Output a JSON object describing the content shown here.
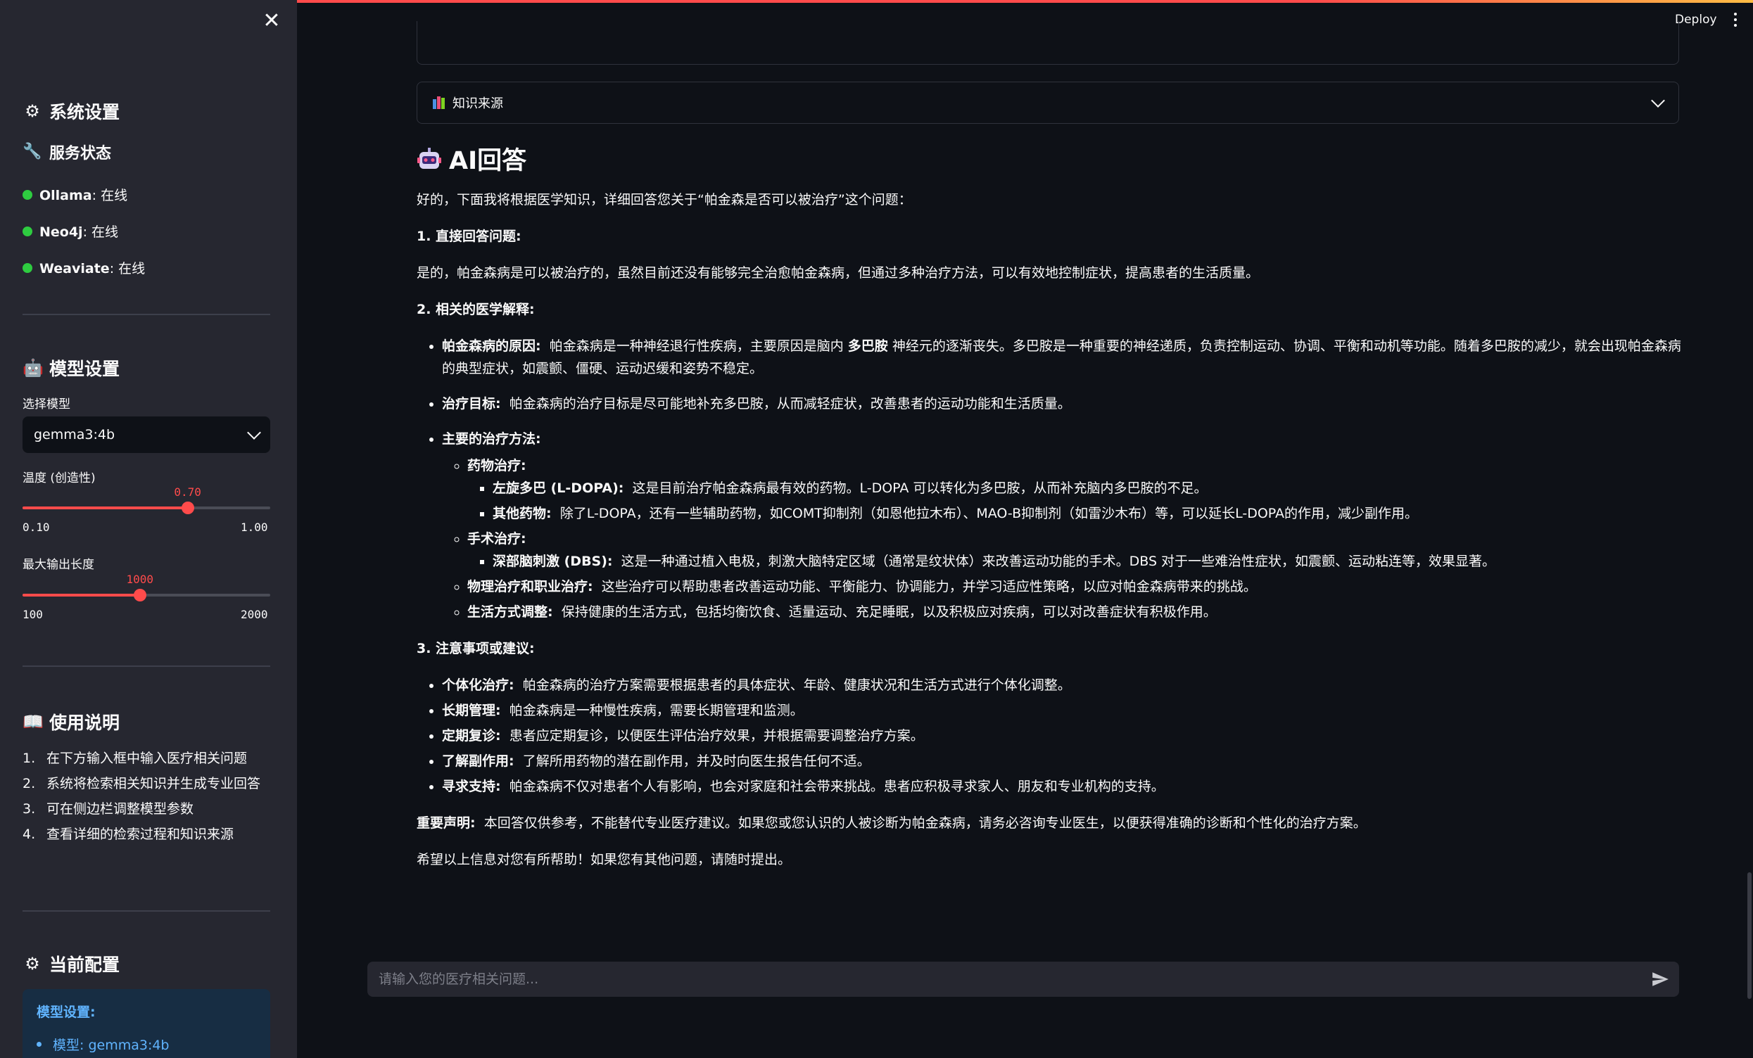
{
  "header": {
    "deploy_label": "Deploy"
  },
  "sidebar": {
    "system_settings": "系统设置",
    "service_status": "服务状态",
    "services": [
      {
        "name": "Ollama",
        "status": ": 在线"
      },
      {
        "name": "Neo4j",
        "status": ": 在线"
      },
      {
        "name": "Weaviate",
        "status": ": 在线"
      }
    ],
    "model_settings": "模型设置",
    "select_model_label": "选择模型",
    "selected_model": "gemma3:4b",
    "temperature": {
      "label": "温度 (创造性)",
      "value": "0.70",
      "fraction": 0.6667,
      "min": "0.10",
      "max": "1.00"
    },
    "max_length": {
      "label": "最大输出长度",
      "value": "1000",
      "fraction": 0.4737,
      "min": "100",
      "max": "2000"
    },
    "usage_title": "使用说明",
    "usage_items": [
      {
        "num": "1.",
        "text": "在下方输入框中输入医疗相关问题"
      },
      {
        "num": "2.",
        "text": "系统将检索相关知识并生成专业回答"
      },
      {
        "num": "3.",
        "text": "可在侧边栏调整模型参数"
      },
      {
        "num": "4.",
        "text": "查看详细的检索过程和知识来源"
      }
    ],
    "current_config": "当前配置",
    "config_box": {
      "title": "模型设置:",
      "item": "模型: gemma3:4b"
    }
  },
  "main": {
    "expander_label": "知识来源",
    "answer_title": "AI回答",
    "intro": "好的，下面我将根据医学知识，详细回答您关于“帕金森是否可以被治疗”这个问题：",
    "s1_title": "1. 直接回答问题:",
    "s1_text": "是的，帕金森病是可以被治疗的，虽然目前还没有能够完全治愈帕金森病，但通过多种治疗方法，可以有效地控制症状，提高患者的生活质量。",
    "s2_title": "2. 相关的医学解释:",
    "cause_label": "帕金森病的原因:",
    "cause_text_a": "帕金森病是一种神经退行性疾病，主要原因是脑内",
    "cause_bold": "多巴胺",
    "cause_text_b": "神经元的逐渐丧失。多巴胺是一种重要的神经递质，负责控制运动、协调、平衡和动机等功能。随着多巴胺的减少，就会出现帕金森病的典型症状，如震颤、僵硬、运动迟缓和姿势不稳定。",
    "goal_label": "治疗目标:",
    "goal_text": "帕金森病的治疗目标是尽可能地补充多巴胺，从而减轻症状，改善患者的运动功能和生活质量。",
    "methods_label": "主要的治疗方法:",
    "drug_label": "药物治疗:",
    "ldopa_label": "左旋多巴 (L-DOPA):",
    "ldopa_text": "这是目前治疗帕金森病最有效的药物。L-DOPA 可以转化为多巴胺，从而补充脑内多巴胺的不足。",
    "other_label": "其他药物:",
    "other_text": "除了L-DOPA，还有一些辅助药物，如COMT抑制剂（如恩他拉木布）、MAO-B抑制剂（如雷沙木布）等，可以延长L-DOPA的作用，减少副作用。",
    "surgery_label": "手术治疗:",
    "dbs_label": "深部脑刺激 (DBS):",
    "dbs_text": "这是一种通过植入电极，刺激大脑特定区域（通常是纹状体）来改善运动功能的手术。DBS 对于一些难治性症状，如震颤、运动粘连等，效果显著。",
    "pt_label": "物理治疗和职业治疗:",
    "pt_text": "这些治疗可以帮助患者改善运动功能、平衡能力、协调能力，并学习适应性策略，以应对帕金森病带来的挑战。",
    "life_label": "生活方式调整:",
    "life_text": "保持健康的生活方式，包括均衡饮食、适量运动、充足睡眠，以及积极应对疾病，可以对改善症状有积极作用。",
    "s3_title": "3. 注意事项或建议:",
    "notes": [
      {
        "label": "个体化治疗:",
        "text": "帕金森病的治疗方案需要根据患者的具体症状、年龄、健康状况和生活方式进行个体化调整。"
      },
      {
        "label": "长期管理:",
        "text": "帕金森病是一种慢性疾病，需要长期管理和监测。"
      },
      {
        "label": "定期复诊:",
        "text": "患者应定期复诊，以便医生评估治疗效果，并根据需要调整治疗方案。"
      },
      {
        "label": "了解副作用:",
        "text": "了解所用药物的潜在副作用，并及时向医生报告任何不适。"
      },
      {
        "label": "寻求支持:",
        "text": "帕金森病不仅对患者个人有影响，也会对家庭和社会带来挑战。患者应积极寻求家人、朋友和专业机构的支持。"
      }
    ],
    "disclaimer_label": "重要声明:",
    "disclaimer_text": "本回答仅供参考，不能替代专业医疗建议。如果您或您认识的人被诊断为帕金森病，请务必咨询专业医生，以便获得准确的诊断和个性化的治疗方案。",
    "closing": "希望以上信息对您有所帮助！如果您有其他问题，请随时提出。"
  },
  "chat": {
    "placeholder": "请输入您的医疗相关问题..."
  },
  "colors": {
    "accent": "#ff4b4b",
    "online": "#2ecc40",
    "info_text": "#60b4ff",
    "info_bg": "#172d43"
  }
}
